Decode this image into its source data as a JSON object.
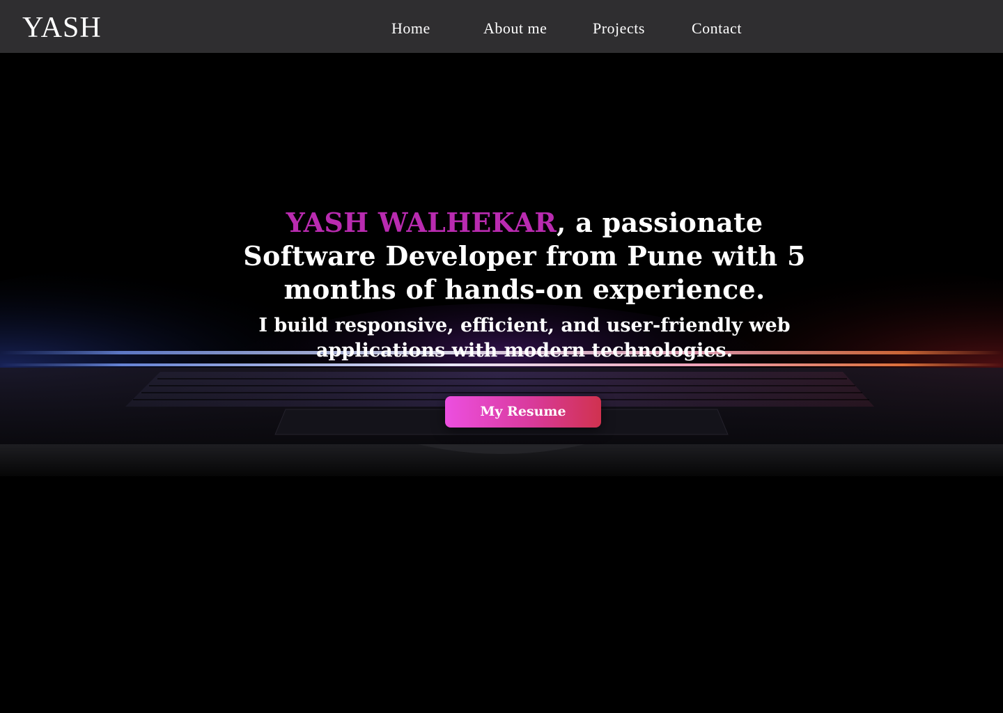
{
  "nav": {
    "logo": "YASH",
    "links": [
      {
        "label": "Home"
      },
      {
        "label": "About me"
      },
      {
        "label": "Projects"
      },
      {
        "label": "Contact"
      }
    ]
  },
  "hero": {
    "name": "YASH WALHEKAR",
    "headline_rest": ", a passionate Software Developer from Pune with 5 months of hands-on experience.",
    "subheadline": "I build responsive, efficient, and user-friendly web applications with modern technologies.",
    "resume_button": "My Resume",
    "background": "laptop-keyboard-glow-image"
  },
  "colors": {
    "page_background": "#000000",
    "navbar": "#2f2e30",
    "name_accent": "#b92bb0",
    "button_gradient_start": "#ec4fe0",
    "button_gradient_end": "#d0324f",
    "text": "#ffffff"
  }
}
